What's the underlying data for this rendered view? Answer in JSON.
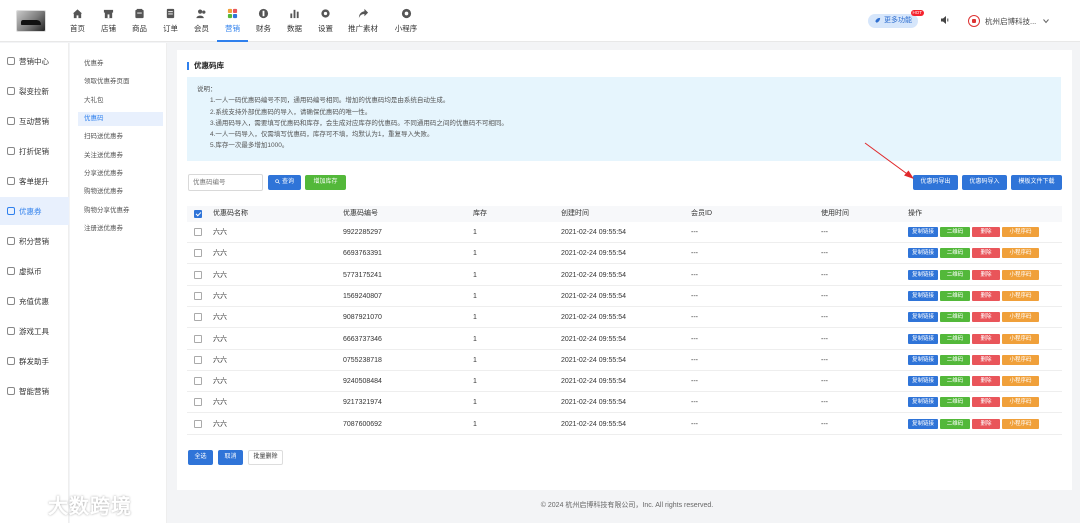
{
  "nav": {
    "items": [
      {
        "label": "首页",
        "icon": "home-icon"
      },
      {
        "label": "店铺",
        "icon": "store-icon"
      },
      {
        "label": "商品",
        "icon": "goods-icon"
      },
      {
        "label": "订单",
        "icon": "order-icon"
      },
      {
        "label": "会员",
        "icon": "member-icon"
      },
      {
        "label": "营销",
        "icon": "marketing-icon",
        "active": true
      },
      {
        "label": "财务",
        "icon": "finance-icon"
      },
      {
        "label": "数据",
        "icon": "data-icon"
      },
      {
        "label": "设置",
        "icon": "settings-icon"
      },
      {
        "label": "推广素材",
        "icon": "share-icon"
      },
      {
        "label": "小程序",
        "icon": "miniprogram-icon"
      }
    ],
    "more_label": "更多功能",
    "hot_badge": "HOT",
    "company": "杭州启博科技..."
  },
  "sidebar": {
    "items": [
      {
        "label": "营销中心"
      },
      {
        "label": "裂变拉新"
      },
      {
        "label": "互动营销"
      },
      {
        "label": "打折促销"
      },
      {
        "label": "客单提升"
      },
      {
        "label": "优惠券",
        "active": true
      },
      {
        "label": "积分营销"
      },
      {
        "label": "虚拟币"
      },
      {
        "label": "充值优惠"
      },
      {
        "label": "游戏工具"
      },
      {
        "label": "群发助手"
      },
      {
        "label": "智能营销"
      }
    ]
  },
  "submenu": {
    "items": [
      {
        "label": "优惠券"
      },
      {
        "label": "领取优惠券页面"
      },
      {
        "label": "大礼包"
      },
      {
        "label": "优惠码",
        "active": true
      },
      {
        "label": "扫码送优惠券"
      },
      {
        "label": "关注送优惠券"
      },
      {
        "label": "分享送优惠券"
      },
      {
        "label": "购物送优惠券"
      },
      {
        "label": "购物分享优惠券"
      },
      {
        "label": "注册送优惠券"
      }
    ]
  },
  "main": {
    "title": "优惠码库",
    "notice": {
      "heading": "说明：",
      "lines": [
        "1.一人一码优惠码编号不同，通用码编号相同。增加的优惠码均是由系统自动生成。",
        "2.系统支持外部优惠码的导入，请确保优惠码的唯一性。",
        "3.通用码导入，需要填写优惠码和库存，会生成对应库存的优惠码。不同通用码之间的优惠码不可相同。",
        "4.一人一码导入，仅需填写优惠码，库存可不填，均默认为1，重复导入失败。",
        "5.库存一次最多增加1000。"
      ]
    },
    "search_placeholder": "优惠码编号",
    "search_button": "查询",
    "add_stock_button": "增加库存",
    "export_button": "优惠码导出",
    "import_button": "优惠码导入",
    "template_button": "模板文件下载",
    "table": {
      "headers": [
        "优惠码名称",
        "优惠码编号",
        "库存",
        "创建时间",
        "会员ID",
        "使用时间",
        "操作"
      ],
      "actions": [
        "复制链接",
        "二维码",
        "删除",
        "小程序码"
      ],
      "rows": [
        {
          "name": "六六",
          "code": "9922285297",
          "stock": "1",
          "created": "2021-02-24 09:55:54",
          "member": "---",
          "used": "---"
        },
        {
          "name": "六六",
          "code": "6693763391",
          "stock": "1",
          "created": "2021-02-24 09:55:54",
          "member": "---",
          "used": "---"
        },
        {
          "name": "六六",
          "code": "5773175241",
          "stock": "1",
          "created": "2021-02-24 09:55:54",
          "member": "---",
          "used": "---"
        },
        {
          "name": "六六",
          "code": "1569240807",
          "stock": "1",
          "created": "2021-02-24 09:55:54",
          "member": "---",
          "used": "---"
        },
        {
          "name": "六六",
          "code": "9087921070",
          "stock": "1",
          "created": "2021-02-24 09:55:54",
          "member": "---",
          "used": "---"
        },
        {
          "name": "六六",
          "code": "6663737346",
          "stock": "1",
          "created": "2021-02-24 09:55:54",
          "member": "---",
          "used": "---"
        },
        {
          "name": "六六",
          "code": "0755238718",
          "stock": "1",
          "created": "2021-02-24 09:55:54",
          "member": "---",
          "used": "---"
        },
        {
          "name": "六六",
          "code": "9240508484",
          "stock": "1",
          "created": "2021-02-24 09:55:54",
          "member": "---",
          "used": "---"
        },
        {
          "name": "六六",
          "code": "9217321974",
          "stock": "1",
          "created": "2021-02-24 09:55:54",
          "member": "---",
          "used": "---"
        },
        {
          "name": "六六",
          "code": "7087600692",
          "stock": "1",
          "created": "2021-02-24 09:55:54",
          "member": "---",
          "used": "---"
        }
      ]
    },
    "select_all_button": "全选",
    "cancel_button": "取消",
    "batch_delete_button": "批量删除"
  },
  "footer": "© 2024 杭州启博科技有限公司，Inc. All rights reserved.",
  "watermark": "大数跨境",
  "colors": {
    "accent": "#2f74d8",
    "green": "#53b83a",
    "danger": "#e9555a",
    "orange": "#f0a03a",
    "annotation_arrow": "#e0292b"
  }
}
